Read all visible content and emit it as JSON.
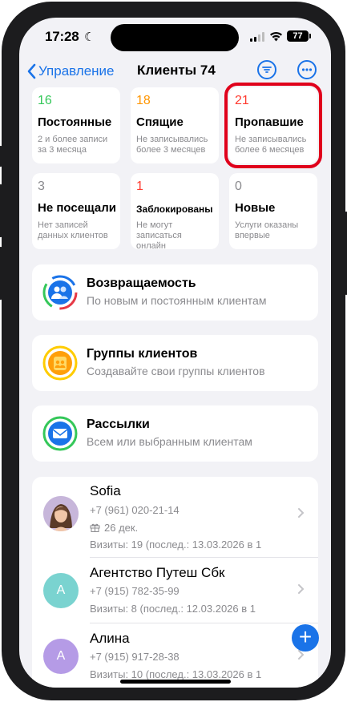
{
  "status_bar": {
    "time": "17:28",
    "battery": "77"
  },
  "nav": {
    "back_label": "Управление",
    "title": "Клиенты 74"
  },
  "segments": [
    {
      "count": "16",
      "title": "Постоянные",
      "desc": "2 и более записи за 3 месяца",
      "color": "#34c759",
      "highlighted": false
    },
    {
      "count": "18",
      "title": "Спящие",
      "desc": "Не записывались более 3 месяцев",
      "color": "#ff9500",
      "highlighted": false
    },
    {
      "count": "21",
      "title": "Пропавшие",
      "desc": "Не записывались более 6 месяцев",
      "color": "#ff3b30",
      "highlighted": true
    },
    {
      "count": "3",
      "title": "Не посещали",
      "desc": "Нет записей данных клиентов",
      "color": "#8a8a8e",
      "highlighted": false
    },
    {
      "count": "1",
      "title": "Заблокированы",
      "desc": "Не могут записаться онлайн",
      "color": "#ff3b30",
      "highlighted": false
    },
    {
      "count": "0",
      "title": "Новые",
      "desc": "Услуги оказаны впервые",
      "color": "#8a8a8e",
      "highlighted": false
    }
  ],
  "features": [
    {
      "title": "Возвращаемость",
      "subtitle": "По новым и постоянным клиентам",
      "icon": "users-return-icon"
    },
    {
      "title": "Группы клиентов",
      "subtitle": "Создавайте свои группы клиентов",
      "icon": "client-groups-icon"
    },
    {
      "title": "Рассылки",
      "subtitle": "Всем или выбранным клиентам",
      "icon": "mail-icon"
    }
  ],
  "clients": [
    {
      "name": "Sofia",
      "phone": "+7 (961) 020-21-14",
      "birthday": "26 дек.",
      "visits": "Визиты: 19 (послед.: 13.03.2026 в 1",
      "avatar": "photo"
    },
    {
      "name": "Агентство Путеш Сбк",
      "phone": "+7 (915) 782-35-99",
      "visits": "Визиты: 8 (послед.: 12.03.2026 в 1",
      "avatar": "А",
      "avatar_color": "#7ad3d0"
    },
    {
      "name": "Алина",
      "phone": "+7 (915) 917-28-38",
      "visits": "Визиты: 10 (послед.: 13.03.2026 в 1",
      "avatar": "А",
      "avatar_color": "#b59be6"
    }
  ],
  "colors": {
    "accent": "#1a73e8",
    "highlight_border": "#e0001b"
  }
}
